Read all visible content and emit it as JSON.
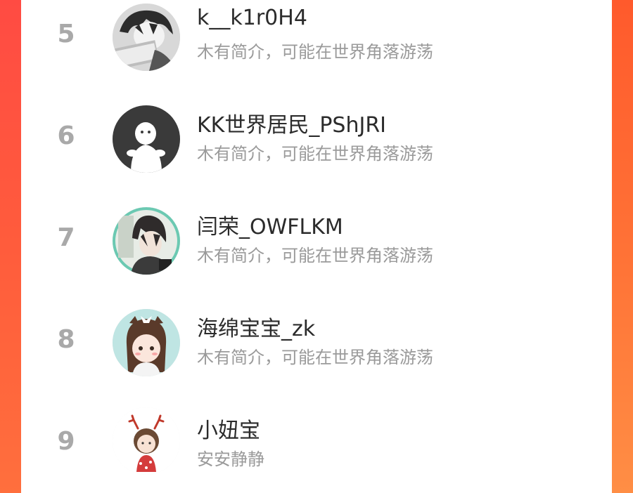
{
  "users": [
    {
      "rank": "5",
      "name": "k__k1r0H4",
      "bio": "木有简介，可能在世界角落游荡",
      "avatar": "anime-boy-reading-avatar"
    },
    {
      "rank": "6",
      "name": "KK世界居民_PShJRI",
      "bio": "木有简介，可能在世界角落游荡",
      "avatar": "default-ghost-avatar"
    },
    {
      "rank": "7",
      "name": "闫荣_OWFLKM",
      "bio": "木有简介，可能在世界角落游荡",
      "avatar": "anime-boy-avatar"
    },
    {
      "rank": "8",
      "name": "海绵宝宝_zk",
      "bio": "木有简介，可能在世界角落游荡",
      "avatar": "cartoon-girl-avatar"
    },
    {
      "rank": "9",
      "name": "小妞宝",
      "bio": "安安静静",
      "avatar": "reindeer-girl-avatar"
    }
  ],
  "colors": {
    "accent_left": "#ff4b43",
    "accent_right": "#ff7a3a",
    "rank_text": "#a9a9a9",
    "name_text": "#2b2b2b",
    "bio_text": "#9a9a9a"
  }
}
